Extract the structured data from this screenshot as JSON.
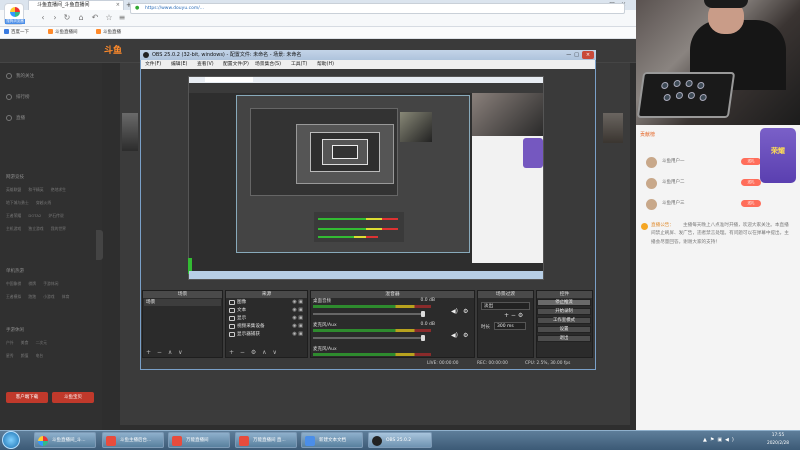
{
  "browser": {
    "tab_title": "斗鱼直播间_斗鱼直播间",
    "new_tab": "+",
    "url": "https://www.douyu.com/...",
    "app_logo_label": "搜狗浏览器",
    "bookmarks": [
      "百度一下",
      "斗鱼直播间",
      "斗鱼直播"
    ]
  },
  "douyu": {
    "logo": "斗鱼",
    "left_nav": [
      "我的关注",
      "排行榜",
      "直播"
    ],
    "section_headers": [
      "网游竞技",
      "单机热游",
      "手游休闲"
    ],
    "nav_rows": [
      "英雄联盟 和平精英 绝地求生",
      "地下城与勇士 穿越火线",
      "王者荣耀 DOTA2 炉石传说",
      "主机游戏 独立游戏 我的世界",
      "中国象棋 棋牌 手游休闲",
      "王者模拟 跑跑 小游戏 体育",
      "户外 美食 二次元",
      "星秀 颜值 电台"
    ],
    "bottom_buttons": [
      "客户端下载",
      "斗鱼宝贝"
    ],
    "announcement_label": "直播公告：",
    "announcement": "主播每天晚上八点准时开播，欢迎大家关注。本直播间禁止刷屏、发广告，违者禁言处理。有问题可以在弹幕中提出，主播会尽量回答。谢谢大家的支持！",
    "rank_title": "贡献榜",
    "rank": [
      {
        "name": "斗鱼用户一",
        "action": "送礼"
      },
      {
        "name": "斗鱼用户二",
        "action": "送礼"
      },
      {
        "name": "斗鱼用户三",
        "action": "送礼"
      }
    ],
    "gift_label": "荣耀"
  },
  "obs": {
    "title": "OBS 25.0.2 (32-bit, windows) - 配置文件: 未命名 - 场景: 未命名",
    "menu": [
      "文件(F)",
      "编辑(E)",
      "查看(V)",
      "配置文件(P)",
      "场景集合(S)",
      "工具(T)",
      "帮助(H)"
    ],
    "docks": {
      "scenes": "场景",
      "sources": "来源",
      "mixer": "混音器",
      "transitions": "场景过渡",
      "controls": "控件"
    },
    "scene_item": "场景",
    "sources": [
      "图像",
      "文本",
      "显示",
      "视频采集设备",
      "显示器捕获"
    ],
    "mixer": [
      {
        "label": "桌面音频",
        "db": "0.0 dB"
      },
      {
        "label": "麦克风/Aux",
        "db": "0.0 dB"
      },
      {
        "label": "麦克风/Aux",
        "db": "0.0 dB"
      }
    ],
    "transition": {
      "type": "淡出",
      "duration_label": "时长",
      "duration": "300 ms"
    },
    "controls": [
      "停止推流",
      "开始录制",
      "工作室模式",
      "设置",
      "退出"
    ],
    "status": {
      "live": "LIVE: 00:00:00",
      "rec": "REC: 00:00:00",
      "cpu": "CPU: 2.5%, 30.00 fps"
    },
    "dock_footer": "+ − ∧ ∨"
  },
  "taskbar": {
    "items": [
      {
        "label": "斗鱼直播间_斗...",
        "color": "#e84c3d"
      },
      {
        "label": "斗鱼主播后台...",
        "color": "#e84c3d"
      },
      {
        "label": "万能直播间",
        "color": "#e84c3d"
      },
      {
        "label": "万能直播间 直...",
        "color": "#e84c3d"
      },
      {
        "label": "新建文本文档",
        "color": "#4b8ee8"
      },
      {
        "label": "OBS 25.0.2",
        "color": "#222222"
      }
    ],
    "time": "17:55",
    "date": "2020/2/28"
  }
}
